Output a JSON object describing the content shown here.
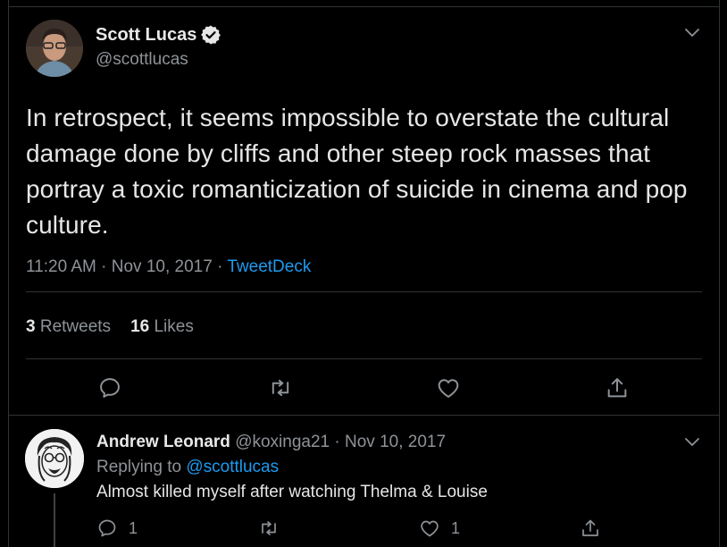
{
  "tweet": {
    "author_name": "Scott Lucas",
    "author_handle": "@scottlucas",
    "text": "In retrospect, it seems impossible to overstate the cultural damage done by cliffs and other steep rock masses that portray a toxic romanticization of suicide in cinema and pop culture.",
    "time": "11:20 AM",
    "date": "Nov 10, 2017",
    "source": "TweetDeck",
    "separator": "·",
    "retweet_count": "3",
    "retweet_label": "Retweets",
    "like_count": "16",
    "like_label": "Likes"
  },
  "reply": {
    "author_name": "Andrew Leonard",
    "author_handle": "@koxinga21",
    "date": "Nov 10, 2017",
    "separator": "·",
    "replying_prefix": "Replying to",
    "replying_to": "@scottlucas",
    "text": "Almost killed myself after watching Thelma & Louise",
    "reply_count": "1",
    "like_count": "1"
  },
  "icons": {
    "verified": "verified-badge-icon",
    "menu": "chevron-down-icon",
    "reply": "reply-icon",
    "retweet": "retweet-icon",
    "like": "heart-icon",
    "share": "share-icon"
  },
  "colors": {
    "background": "#000000",
    "link": "#1d9bf0",
    "muted": "#8e9398",
    "text": "#e6e6e6",
    "divider": "#2f3336"
  }
}
